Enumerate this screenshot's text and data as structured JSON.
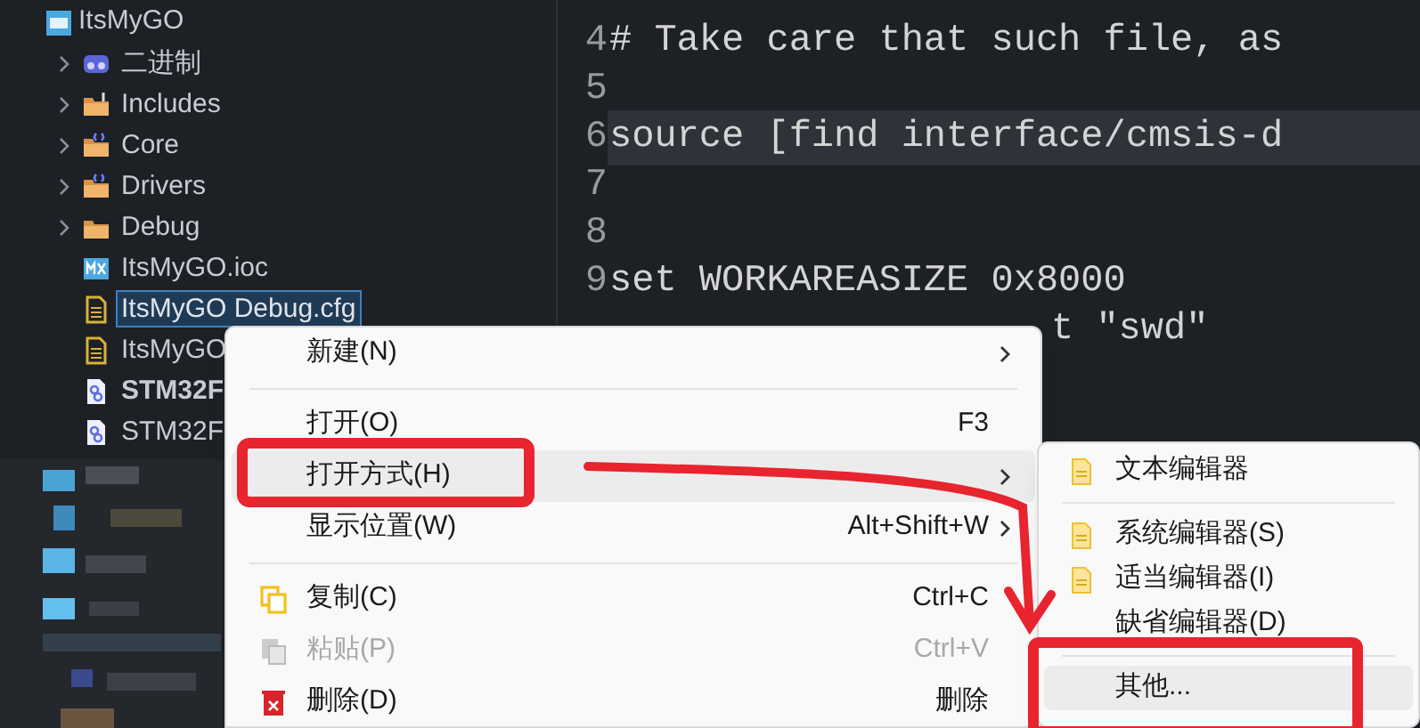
{
  "project_tree": {
    "root": {
      "label": "ItsMyGO"
    },
    "items": [
      {
        "label": "二进制",
        "kind": "binaries",
        "expanded": false,
        "selected": false,
        "bold": false
      },
      {
        "label": "Includes",
        "kind": "folder-include",
        "expanded": false,
        "selected": false,
        "bold": false
      },
      {
        "label": "Core",
        "kind": "folder-source",
        "expanded": false,
        "selected": false,
        "bold": false
      },
      {
        "label": "Drivers",
        "kind": "folder-source",
        "expanded": false,
        "selected": false,
        "bold": false
      },
      {
        "label": "Debug",
        "kind": "folder",
        "expanded": false,
        "selected": false,
        "bold": false
      },
      {
        "label": "ItsMyGO.ioc",
        "kind": "mx",
        "selected": false,
        "bold": false
      },
      {
        "label": "ItsMyGO Debug.cfg",
        "kind": "text-file",
        "selected": true,
        "bold": false
      },
      {
        "label": "ItsMyGO",
        "kind": "text-file",
        "selected": false,
        "bold": false
      },
      {
        "label": "STM32F",
        "kind": "linker",
        "selected": false,
        "bold": true
      },
      {
        "label": "STM32F",
        "kind": "linker",
        "selected": false,
        "bold": false
      }
    ]
  },
  "editor": {
    "lines": [
      {
        "number": "4",
        "text": "# Take care that such file, as",
        "highlighted": false
      },
      {
        "number": "5",
        "highlighted": false
      },
      {
        "number": "6",
        "text": "source [find interface/cmsis-d",
        "highlighted": true
      },
      {
        "number": "7",
        "highlighted": false
      },
      {
        "number": "8",
        "highlighted": false
      },
      {
        "number": "9",
        "text": "set WORKAREASIZE 0x8000",
        "highlighted": false
      },
      {
        "text": "t \"swd\"",
        "highlighted": false
      }
    ]
  },
  "context_menu": {
    "items": [
      {
        "kind": "item",
        "label": "新建(N)",
        "submenu": true,
        "selected": false,
        "disabled": false
      },
      {
        "kind": "separator"
      },
      {
        "kind": "item",
        "label": "打开(O)",
        "shortcut": "F3",
        "submenu": false,
        "selected": false,
        "disabled": false
      },
      {
        "kind": "item",
        "label": "打开方式(H)",
        "submenu": true,
        "selected": true,
        "disabled": false
      },
      {
        "kind": "item",
        "label": "显示位置(W)",
        "shortcut": "Alt+Shift+W",
        "submenu": true,
        "selected": false,
        "disabled": false
      },
      {
        "kind": "separator"
      },
      {
        "kind": "item",
        "label": "复制(C)",
        "shortcut": "Ctrl+C",
        "submenu": false,
        "selected": false,
        "disabled": false
      },
      {
        "kind": "item",
        "label": "粘贴(P)",
        "shortcut": "Ctrl+V",
        "submenu": false,
        "selected": false,
        "disabled": true
      },
      {
        "kind": "item",
        "label": "删除(D)",
        "shortcut": "删除",
        "submenu": false,
        "selected": false,
        "disabled": false
      }
    ]
  },
  "open_with_submenu": {
    "items": [
      {
        "kind": "item",
        "label": "文本编辑器",
        "selected": false
      },
      {
        "kind": "separator"
      },
      {
        "kind": "item",
        "label": "系统编辑器(S)",
        "selected": false
      },
      {
        "kind": "item",
        "label": "适当编辑器(I)",
        "selected": false
      },
      {
        "kind": "item",
        "label": "缺省编辑器(D)",
        "selected": false
      },
      {
        "kind": "separator"
      },
      {
        "kind": "item",
        "label": "其他...",
        "selected": true
      }
    ]
  }
}
